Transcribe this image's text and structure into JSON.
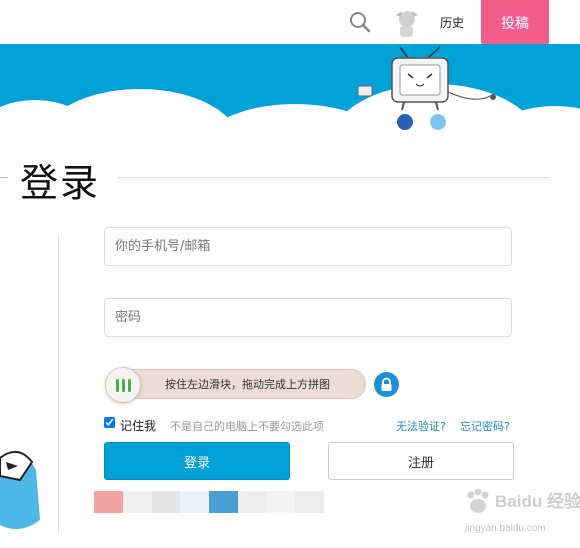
{
  "header": {
    "history_label": "历史",
    "upload_label": "投稿"
  },
  "login": {
    "title": "登录",
    "phone_placeholder": "你的手机号/邮箱",
    "password_placeholder": "密码",
    "slider_hint": "按住左边滑块，拖动完成上方拼图",
    "remember_label": "记住我",
    "remember_hint": "不是自己的电脑上不要勾选此项",
    "cant_verify_label": "无法验证?",
    "forgot_label": "忘记密码?",
    "login_button": "登录",
    "register_button": "注册",
    "remember_checked": true
  },
  "watermark": {
    "brand": "Baidu 经验",
    "url": "jingyan.baidu.com"
  },
  "colors": {
    "accent": "#00a1d6",
    "pink": "#f25d8e",
    "link": "#1e8bc3"
  }
}
